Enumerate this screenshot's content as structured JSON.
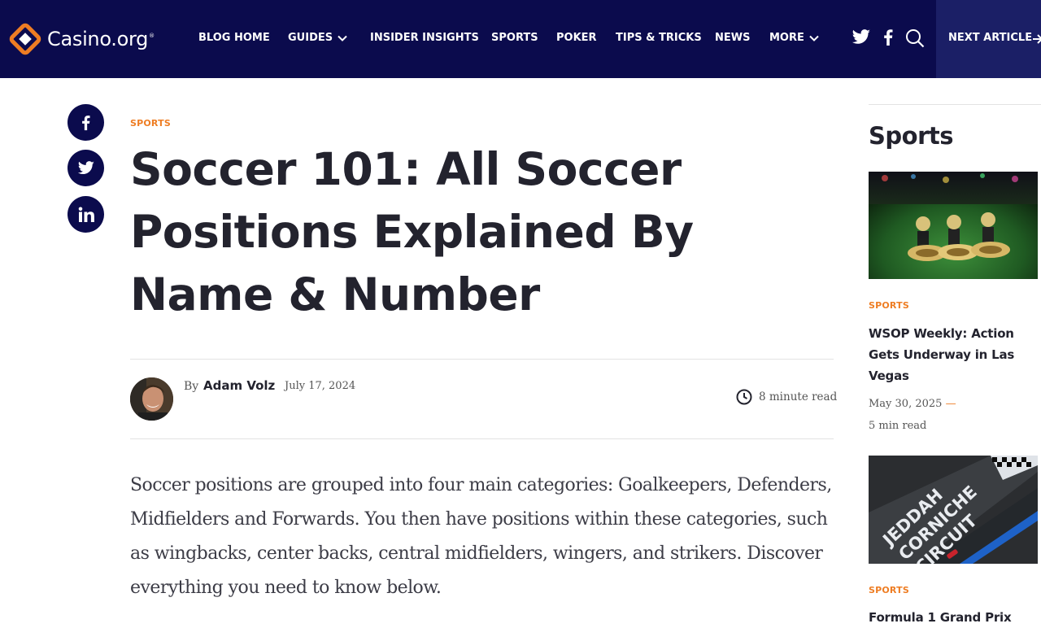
{
  "brand": {
    "name": "Casino.org",
    "mark": "®"
  },
  "nav": {
    "items": [
      {
        "label": "BLOG HOME"
      },
      {
        "label": "GUIDES"
      },
      {
        "label": "INSIDER INSIGHTS"
      },
      {
        "label": "SPORTS"
      },
      {
        "label": "POKER"
      },
      {
        "label": "TIPS & TRICKS"
      },
      {
        "label": "NEWS"
      },
      {
        "label": "MORE"
      }
    ],
    "next_article_label": "NEXT ARTICLE"
  },
  "article": {
    "category": "SPORTS",
    "title": "Soccer 101: All Soccer Positions Explained By Name & Number",
    "byline_prefix": "By",
    "author": "Adam Volz",
    "date": "July 17, 2024",
    "read_time": "8 minute read",
    "intro": "Soccer positions are grouped into four main categories: Goalkeepers, Defenders, Midfielders and Forwards. You then have positions within these categories, such as wingbacks, center backs, central midfielders, wingers, and strikers. Discover everything you need to know below."
  },
  "sidebar": {
    "heading": "Sports",
    "posts": [
      {
        "category": "SPORTS",
        "title": "WSOP Weekly: Action Gets Underway in Las Vegas",
        "date": "May 30, 2025",
        "date_separator": "—",
        "read_time": "5 min read"
      },
      {
        "category": "SPORTS",
        "title": "Formula 1 Grand Prix",
        "image_text": [
          "JEDDAH",
          "CORNICHE",
          "CIRCUIT"
        ]
      }
    ]
  },
  "colors": {
    "header_bg": "#0b0b4d",
    "next_article_bg": "#1b1f66",
    "accent": "#ee7d23",
    "heading_text": "#23232e",
    "body_text": "#3c3c46"
  },
  "icons": [
    "diamond-logo-icon",
    "chevron-down-icon",
    "twitter-icon",
    "facebook-icon",
    "search-icon",
    "arrow-right-icon",
    "linkedin-icon",
    "clock-icon"
  ]
}
